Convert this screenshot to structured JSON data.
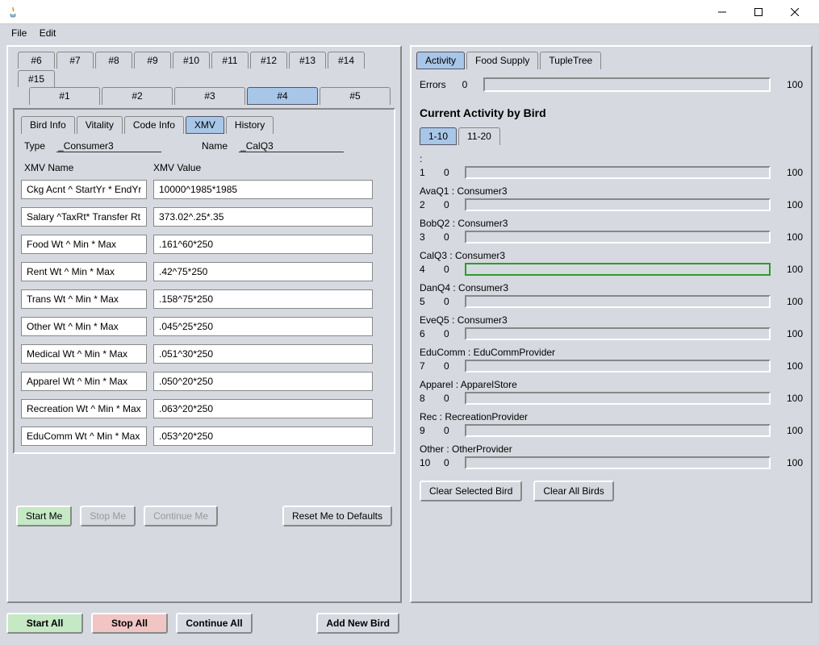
{
  "menubar": {
    "file": "File",
    "edit": "Edit"
  },
  "topTabs1": [
    "#6",
    "#7",
    "#8",
    "#9",
    "#10",
    "#11",
    "#12",
    "#13",
    "#14",
    "#15"
  ],
  "topTabs2": [
    "#1",
    "#2",
    "#3",
    "#4",
    "#5"
  ],
  "activeTopTab": "#4",
  "subTabs": [
    "Bird Info",
    "Vitality",
    "Code Info",
    "XMV",
    "History"
  ],
  "activeSubTab": "XMV",
  "typeLabel": "Type",
  "typeVal": "_Consumer3",
  "nameLabel": "Name",
  "nameVal": "_CalQ3",
  "headers": {
    "name": "XMV Name",
    "value": "XMV Value"
  },
  "xmv": [
    {
      "name": "Ckg Acnt ^ StartYr * EndYr",
      "value": "10000^1985*1985"
    },
    {
      "name": "Salary ^TaxRt* Transfer Rt",
      "value": "373.02^.25*.35"
    },
    {
      "name": "Food Wt ^ Min * Max",
      "value": ".161^60*250"
    },
    {
      "name": "Rent Wt ^ Min * Max",
      "value": ".42^75*250"
    },
    {
      "name": "Trans Wt ^ Min * Max",
      "value": ".158^75*250"
    },
    {
      "name": "Other Wt ^ Min * Max",
      "value": ".045^25*250"
    },
    {
      "name": "Medical Wt ^ Min * Max",
      "value": ".051^30*250"
    },
    {
      "name": "Apparel Wt ^ Min * Max",
      "value": ".050^20*250"
    },
    {
      "name": "Recreation Wt ^ Min * Max",
      "value": ".063^20*250"
    },
    {
      "name": "EduComm Wt ^ Min * Max",
      "value": ".053^20*250"
    }
  ],
  "btns": {
    "startMe": "Start Me",
    "stopMe": "Stop Me",
    "continueMe": "Continue Me",
    "reset": "Reset Me to Defaults",
    "startAll": "Start All",
    "stopAll": "Stop All",
    "continueAll": "Continue All",
    "addNew": "Add New Bird",
    "clearSelected": "Clear Selected Bird",
    "clearAll": "Clear All Birds"
  },
  "rightTabs": [
    "Activity",
    "Food Supply",
    "TupleTree"
  ],
  "activeRightTab": "Activity",
  "errorsLabel": "Errors",
  "errorsVal": "0",
  "errorsMax": "100",
  "activityTitle": "Current Activity by Bird",
  "rangeTabs": [
    "1-10",
    "11-20"
  ],
  "activeRange": "1-10",
  "birds": [
    {
      "idx": "1",
      "label": ":",
      "zero": "0",
      "max": "100",
      "green": false
    },
    {
      "idx": "2",
      "label": "AvaQ1 : Consumer3",
      "zero": "0",
      "max": "100",
      "green": false
    },
    {
      "idx": "3",
      "label": "BobQ2 : Consumer3",
      "zero": "0",
      "max": "100",
      "green": false
    },
    {
      "idx": "4",
      "label": "CalQ3 : Consumer3",
      "zero": "0",
      "max": "100",
      "green": true
    },
    {
      "idx": "5",
      "label": "DanQ4 : Consumer3",
      "zero": "0",
      "max": "100",
      "green": false
    },
    {
      "idx": "6",
      "label": "EveQ5 : Consumer3",
      "zero": "0",
      "max": "100",
      "green": false
    },
    {
      "idx": "7",
      "label": "EduComm : EduCommProvider",
      "zero": "0",
      "max": "100",
      "green": false
    },
    {
      "idx": "8",
      "label": "Apparel : ApparelStore",
      "zero": "0",
      "max": "100",
      "green": false
    },
    {
      "idx": "9",
      "label": "Rec : RecreationProvider",
      "zero": "0",
      "max": "100",
      "green": false
    },
    {
      "idx": "10",
      "label": "Other : OtherProvider",
      "zero": "0",
      "max": "100",
      "green": false
    }
  ]
}
